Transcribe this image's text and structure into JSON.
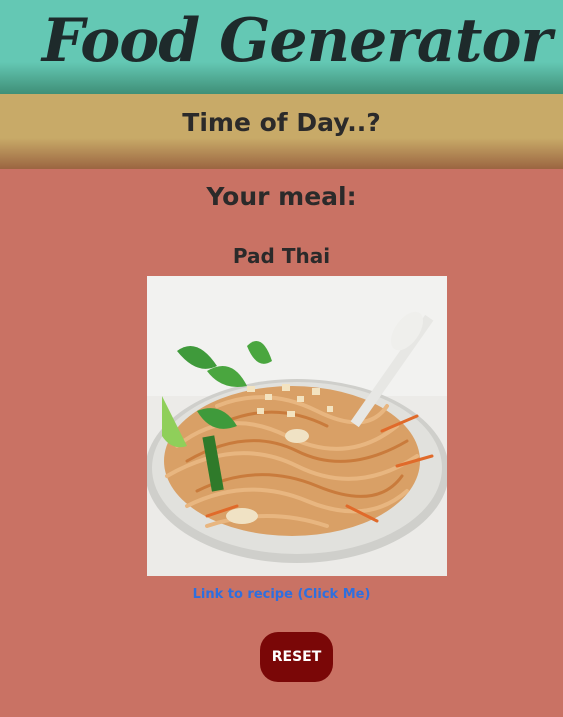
{
  "header": {
    "title": "Food Generator"
  },
  "subheader": {
    "text": "Time of Day..?"
  },
  "main": {
    "heading": "Your meal:",
    "meal_name": "Pad Thai",
    "recipe_link_label": "Link to recipe (Click Me)",
    "reset_label": "RESET"
  },
  "colors": {
    "header_bg": "#64c8b4",
    "subheader_bg": "#c8aa68",
    "page_bg": "#c97264",
    "link": "#2f6fde",
    "reset_button": "#7a0707"
  }
}
